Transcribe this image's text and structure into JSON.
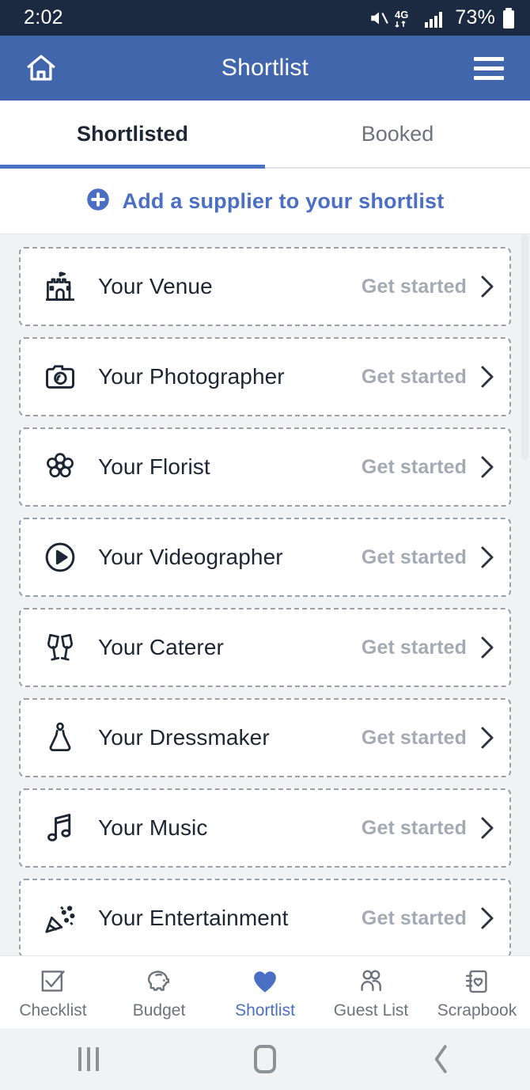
{
  "status_bar": {
    "time": "2:02",
    "battery_percent": "73%",
    "icons": [
      "mute-icon",
      "4g-data-icon",
      "signal-bars-icon",
      "battery-icon"
    ]
  },
  "app_bar": {
    "home_icon": "home-icon",
    "title": "Shortlist",
    "menu_icon": "hamburger-menu-icon"
  },
  "tabs": [
    {
      "label": "Shortlisted",
      "active": true
    },
    {
      "label": "Booked",
      "active": false
    }
  ],
  "add_supplier": {
    "icon": "plus-circle-icon",
    "label": "Add a supplier to your shortlist"
  },
  "suppliers": [
    {
      "icon": "castle-icon",
      "label": "Your Venue",
      "cta": "Get started"
    },
    {
      "icon": "camera-icon",
      "label": "Your Photographer",
      "cta": "Get started"
    },
    {
      "icon": "flower-icon",
      "label": "Your Florist",
      "cta": "Get started"
    },
    {
      "icon": "play-circle-icon",
      "label": "Your Videographer",
      "cta": "Get started"
    },
    {
      "icon": "champagne-icon",
      "label": "Your Caterer",
      "cta": "Get started"
    },
    {
      "icon": "dress-icon",
      "label": "Your Dressmaker",
      "cta": "Get started"
    },
    {
      "icon": "music-note-icon",
      "label": "Your Music",
      "cta": "Get started"
    },
    {
      "icon": "party-popper-icon",
      "label": "Your Entertainment",
      "cta": "Get started"
    }
  ],
  "bottom_nav": [
    {
      "label": "Checklist",
      "icon": "checkbox-icon",
      "active": false
    },
    {
      "label": "Budget",
      "icon": "piggy-bank-icon",
      "active": false
    },
    {
      "label": "Shortlist",
      "icon": "heart-icon",
      "active": true
    },
    {
      "label": "Guest List",
      "icon": "people-icon",
      "active": false
    },
    {
      "label": "Scrapbook",
      "icon": "notebook-icon",
      "active": false
    }
  ],
  "android_nav": {
    "recents": "recents-icon",
    "home": "home-key-icon",
    "back": "back-icon"
  },
  "colors": {
    "status_bar": "#1b2a41",
    "app_bar": "#4266ab",
    "accent": "#4a6fc4",
    "tab_underline": "#4a72c4",
    "page_bg": "#f1f2f4",
    "text_primary": "#1d2633",
    "text_muted": "#a4aab4"
  }
}
